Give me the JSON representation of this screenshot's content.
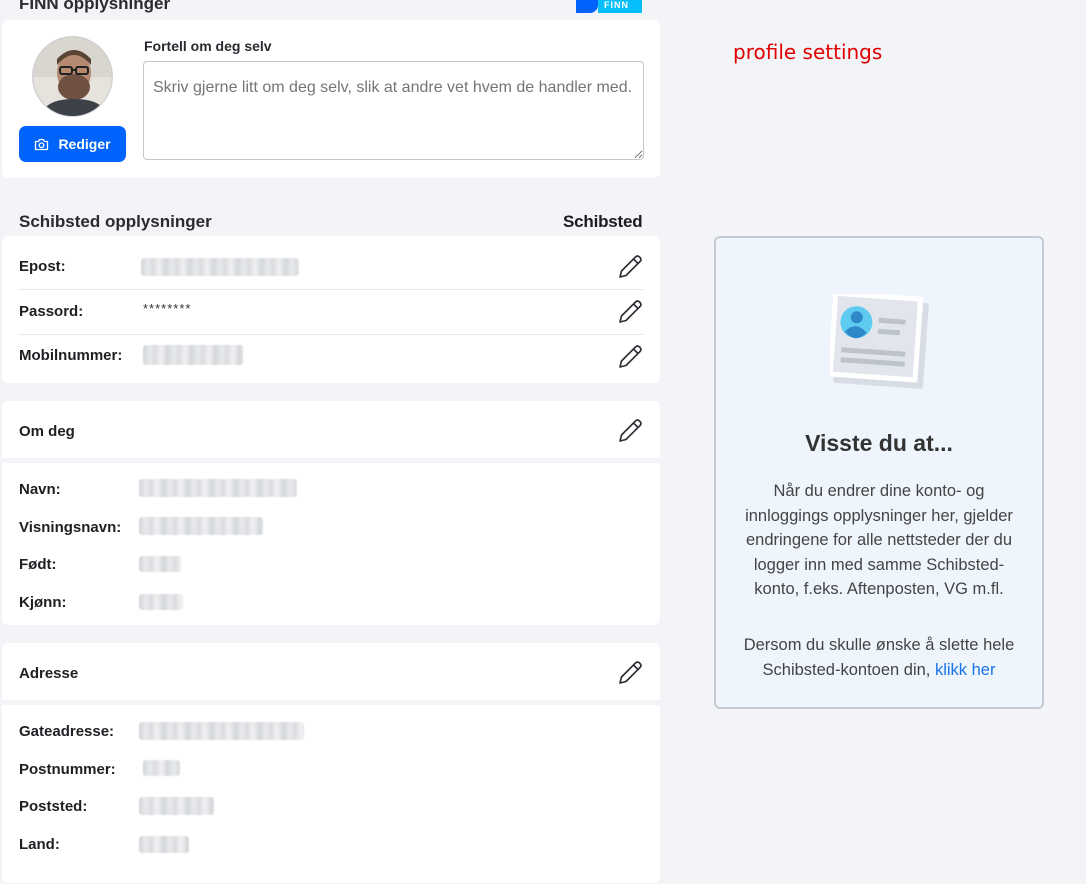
{
  "finn": {
    "title": "FINN opplysninger",
    "logo_text": "FINN",
    "about_label": "Fortell om deg selv",
    "about_placeholder": "Skriv gjerne litt om deg selv, slik at andre vet hvem de handler med.",
    "edit_photo_label": "Rediger"
  },
  "annotation": "profile settings",
  "schibsted": {
    "title": "Schibsted opplysninger",
    "brand": "Schibsted",
    "rows": [
      {
        "label": "Epost:",
        "value": ""
      },
      {
        "label": "Passord:",
        "value": "********"
      },
      {
        "label": "Mobilnummer:",
        "value": ""
      }
    ]
  },
  "om_deg": {
    "title": "Om deg",
    "rows": [
      {
        "label": "Navn:"
      },
      {
        "label": "Visningsnavn:"
      },
      {
        "label": "Født:"
      },
      {
        "label": "Kjønn:"
      }
    ]
  },
  "adresse": {
    "title": "Adresse",
    "rows": [
      {
        "label": "Gateadresse:"
      },
      {
        "label": "Postnummer:"
      },
      {
        "label": "Poststed:"
      },
      {
        "label": "Land:"
      }
    ]
  },
  "info_box": {
    "title": "Visste du at...",
    "paragraph": "Når du endrer dine konto- og innloggings opplysninger her, gjelder endringene for alle nettsteder der du logger inn med samme Schibsted-konto, f.eks. Aftenposten, VG m.fl.",
    "delete_text": "Dersom du skulle ønske å slette hele Schibsted-kontoen din, ",
    "delete_link": "klikk her"
  },
  "colors": {
    "primary": "#0063fb",
    "link": "#1a73e8",
    "annotation": "#e00000",
    "info_bg": "#eef5fd"
  },
  "icons": [
    "camera-icon",
    "pencil-icon",
    "profile-card-icon",
    "finn-logo"
  ]
}
